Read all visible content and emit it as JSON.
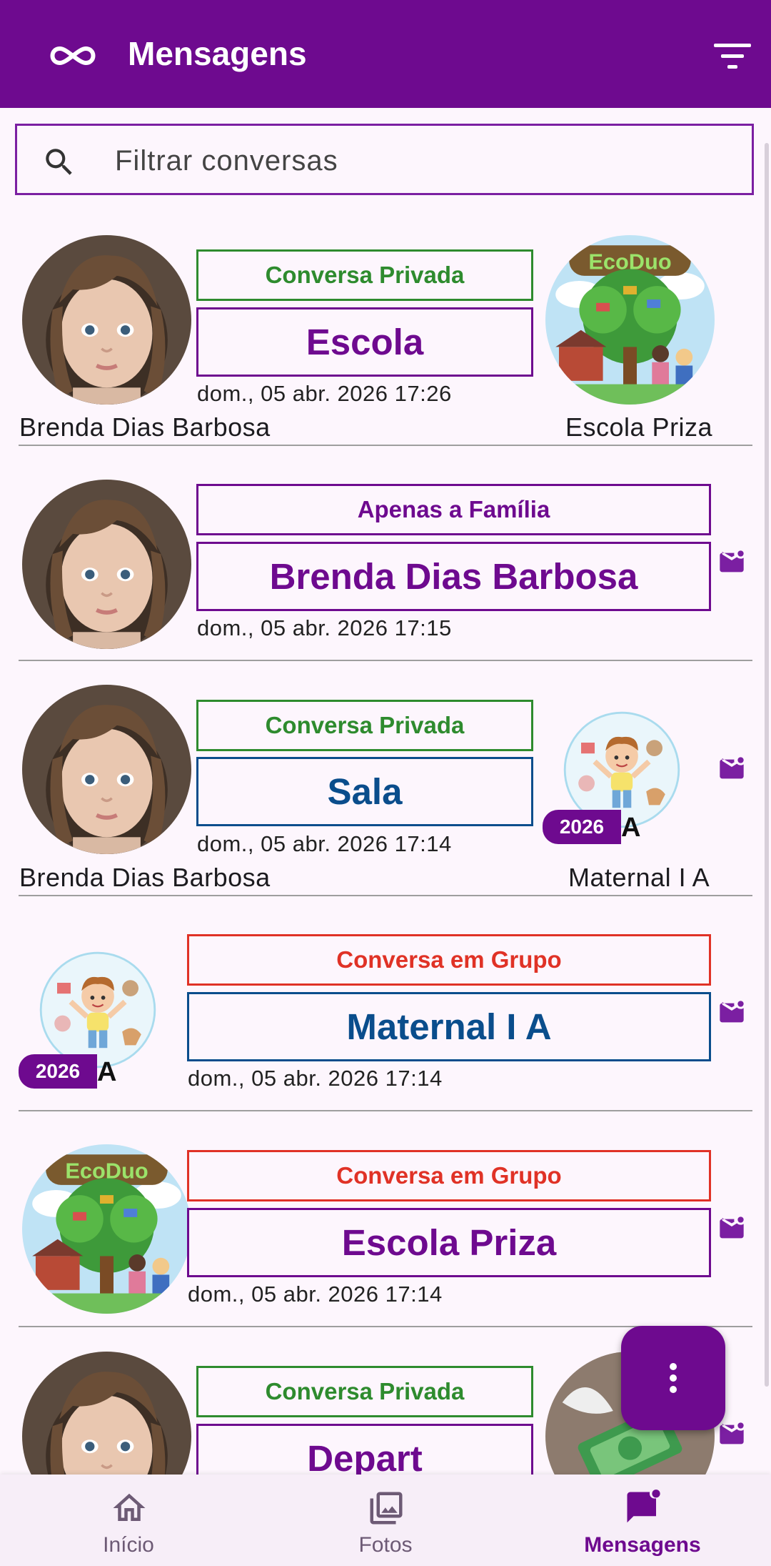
{
  "app": {
    "title": "Mensagens",
    "logo_icon": "infinity-icon",
    "filter_icon": "filter-icon",
    "brand_color": "#6E0A8F"
  },
  "search": {
    "placeholder": "Filtrar conversas",
    "icon": "search-icon"
  },
  "conversations": [
    {
      "type": "Conversa Privada",
      "title": "Escola",
      "date": "dom., 05 abr. 2026 17:26",
      "from": "Brenda Dias Barbosa",
      "to": "Escola Priza"
    },
    {
      "type": "Apenas a Família",
      "title": "Brenda Dias Barbosa",
      "date": "dom., 05 abr. 2026 17:15"
    },
    {
      "type": "Conversa Privada",
      "title": "Sala",
      "date": "dom., 05 abr. 2026 17:14",
      "from": "Brenda Dias Barbosa",
      "to": "Maternal I A",
      "year": "2026",
      "class_letter": "A"
    },
    {
      "type": "Conversa em Grupo",
      "title": "Maternal I A",
      "date": "dom., 05 abr. 2026 17:14",
      "year": "2026",
      "class_letter": "A"
    },
    {
      "type": "Conversa em Grupo",
      "title": "Escola Priza",
      "date": "dom., 05 abr. 2026 17:14"
    },
    {
      "type": "Conversa Privada",
      "title": "Depart"
    }
  ],
  "school_logo_text": "EcoDuo",
  "nav": {
    "items": [
      {
        "label": "Início",
        "icon": "home-icon"
      },
      {
        "label": "Fotos",
        "icon": "photos-icon"
      },
      {
        "label": "Mensagens",
        "icon": "chat-icon",
        "active": true
      }
    ]
  }
}
